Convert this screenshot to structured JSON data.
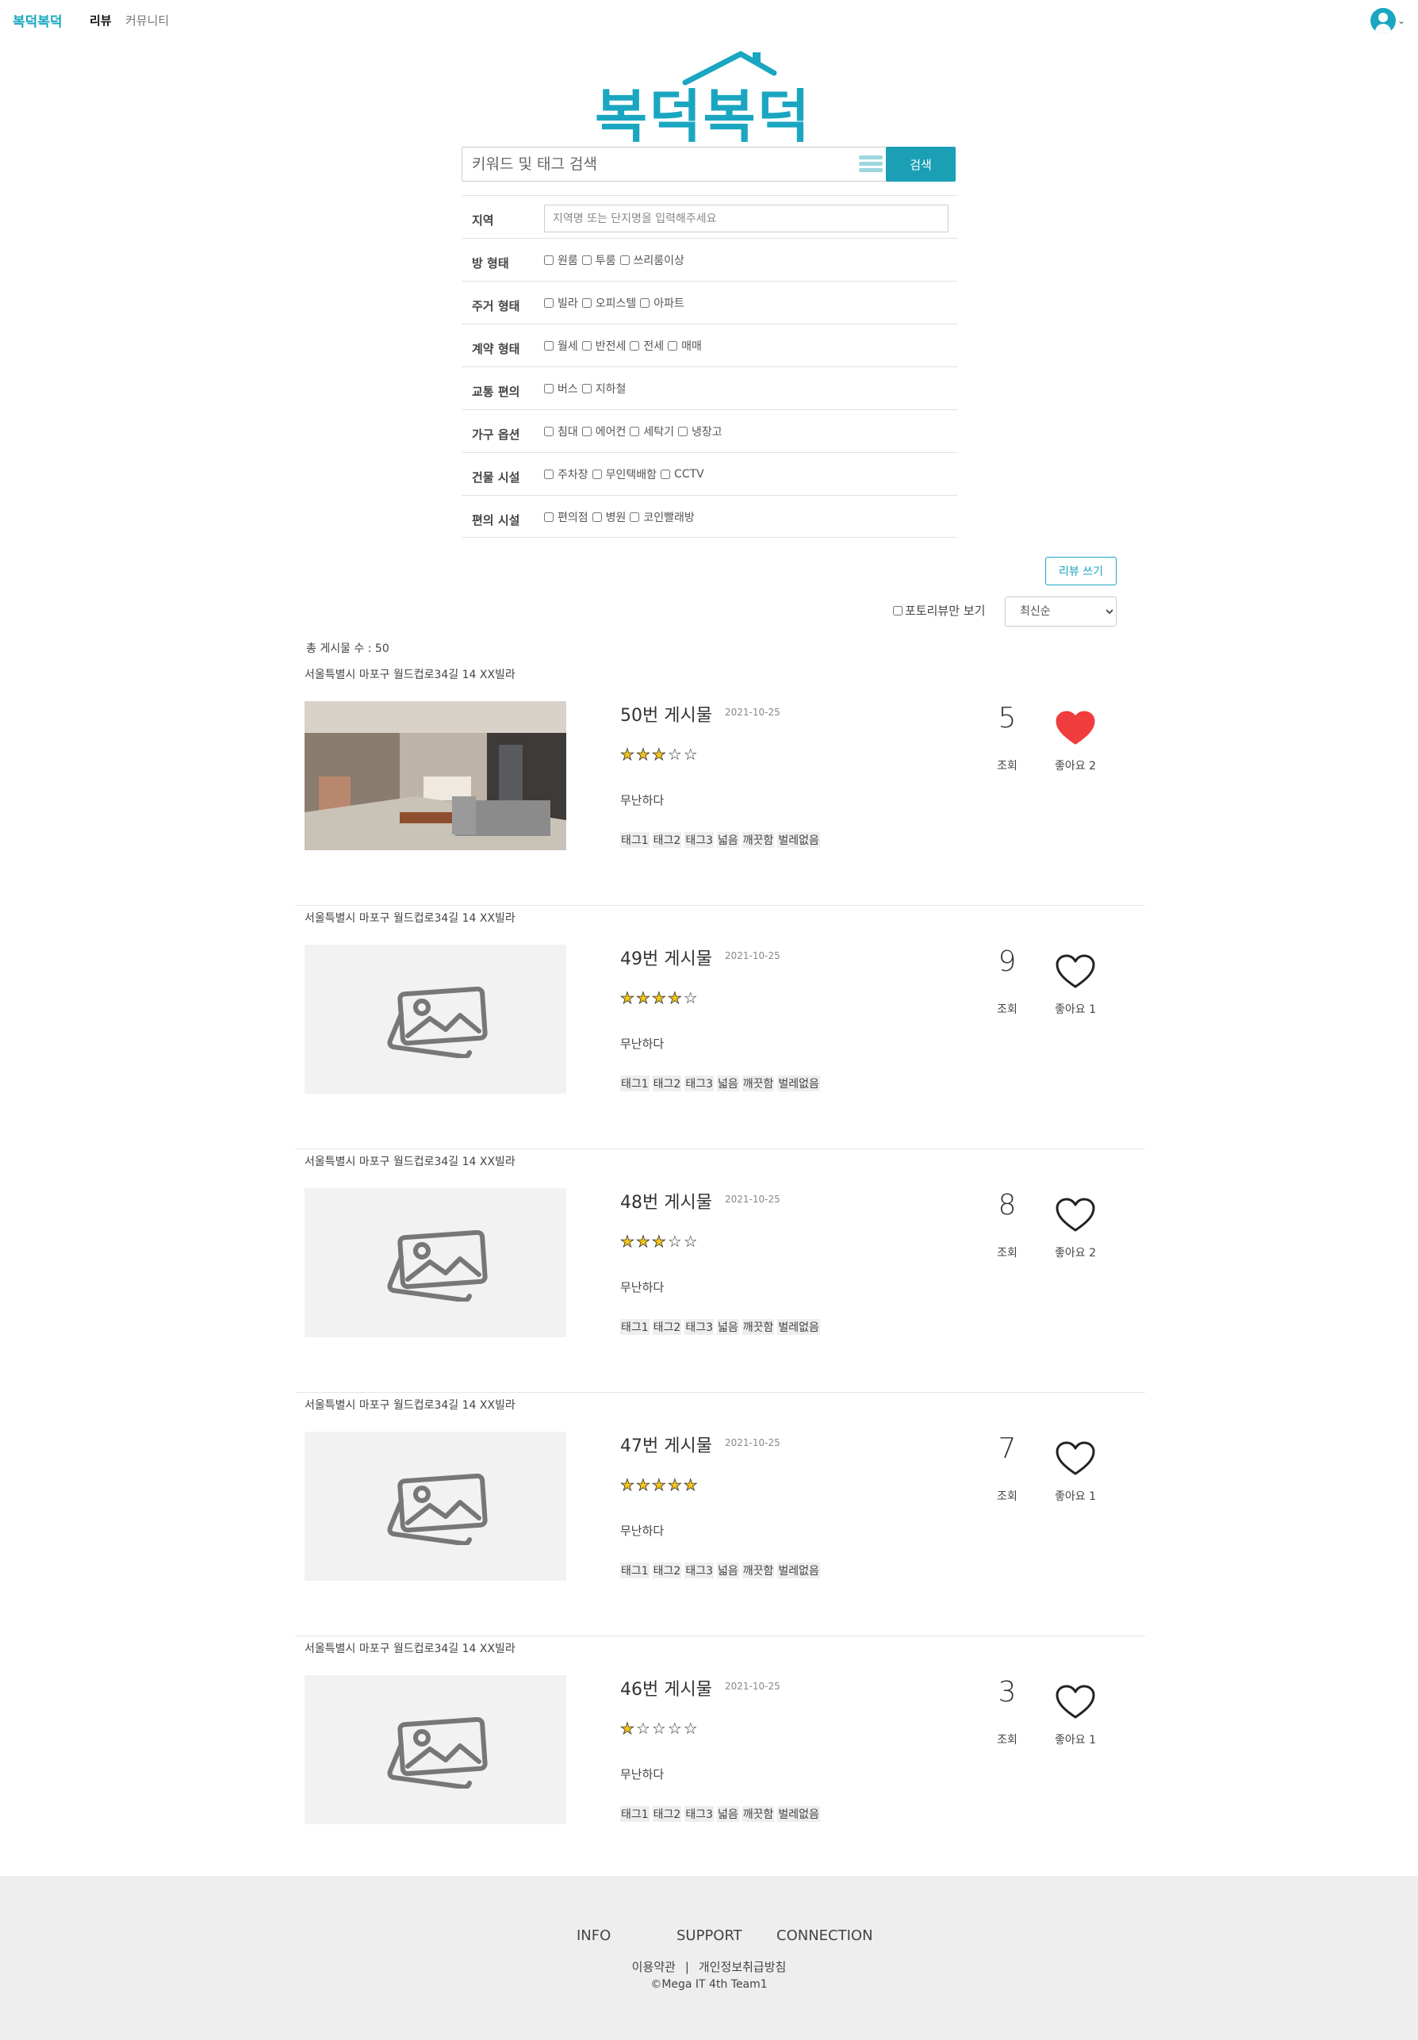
{
  "nav": {
    "brand": "복덕복덕",
    "review": "리뷰",
    "community": "커뮤니티",
    "user_icon": "user-circle-icon",
    "caret_icon": "chevron-down-icon"
  },
  "logo": {
    "text": "복덕복덕",
    "color": "#1aa6c0"
  },
  "search": {
    "placeholder": "키워드 및 태그 검색",
    "button_label": "검색"
  },
  "filters": {
    "region": {
      "label": "지역",
      "placeholder": "지역명 또는 단지명을 입력해주세요"
    },
    "groups": [
      {
        "label": "방 형태",
        "options": [
          "원룸",
          "투룸",
          "쓰리룸이상"
        ]
      },
      {
        "label": "주거 형태",
        "options": [
          "빌라",
          "오피스텔",
          "아파트"
        ]
      },
      {
        "label": "계약 형태",
        "options": [
          "월세",
          "반전세",
          "전세",
          "매매"
        ]
      },
      {
        "label": "교통 편의",
        "options": [
          "버스",
          "지하철"
        ]
      },
      {
        "label": "가구 옵션",
        "options": [
          "침대",
          "에어컨",
          "세탁기",
          "냉장고"
        ]
      },
      {
        "label": "건물 시설",
        "options": [
          "주차장",
          "무인택배함",
          "CCTV"
        ]
      },
      {
        "label": "편의 시설",
        "options": [
          "편의점",
          "병원",
          "코인빨래방"
        ]
      }
    ]
  },
  "controls": {
    "write_button": "리뷰 쓰기",
    "photo_only": "포토리뷰만 보기",
    "sort_selected": "최신순",
    "total_count": "총 게시물 수 : 50"
  },
  "reviews": [
    {
      "address": "서울특별시 마포구 월드컵로34길 14 XX빌라",
      "title": "50번 게시물",
      "date": "2021-10-25",
      "rating": 3,
      "summary": "무난하다",
      "tags": [
        "태그1",
        "태그2",
        "태그3",
        "넓음",
        "깨끗함",
        "벌레없음"
      ],
      "views": "5",
      "views_label": "조회",
      "likes": "좋아요 2",
      "liked": true,
      "has_photo": true
    },
    {
      "address": "서울특별시 마포구 월드컵로34길 14 XX빌라",
      "title": "49번 게시물",
      "date": "2021-10-25",
      "rating": 4,
      "summary": "무난하다",
      "tags": [
        "태그1",
        "태그2",
        "태그3",
        "넓음",
        "깨끗함",
        "벌레없음"
      ],
      "views": "9",
      "views_label": "조회",
      "likes": "좋아요 1",
      "liked": false,
      "has_photo": false
    },
    {
      "address": "서울특별시 마포구 월드컵로34길 14 XX빌라",
      "title": "48번 게시물",
      "date": "2021-10-25",
      "rating": 3,
      "summary": "무난하다",
      "tags": [
        "태그1",
        "태그2",
        "태그3",
        "넓음",
        "깨끗함",
        "벌레없음"
      ],
      "views": "8",
      "views_label": "조회",
      "likes": "좋아요 2",
      "liked": false,
      "has_photo": false
    },
    {
      "address": "서울특별시 마포구 월드컵로34길 14 XX빌라",
      "title": "47번 게시물",
      "date": "2021-10-25",
      "rating": 5,
      "summary": "무난하다",
      "tags": [
        "태그1",
        "태그2",
        "태그3",
        "넓음",
        "깨끗함",
        "벌레없음"
      ],
      "views": "7",
      "views_label": "조회",
      "likes": "좋아요 1",
      "liked": false,
      "has_photo": false
    },
    {
      "address": "서울특별시 마포구 월드컵로34길 14 XX빌라",
      "title": "46번 게시물",
      "date": "2021-10-25",
      "rating": 1,
      "summary": "무난하다",
      "tags": [
        "태그1",
        "태그2",
        "태그3",
        "넓음",
        "깨끗함",
        "벌레없음"
      ],
      "views": "3",
      "views_label": "조회",
      "likes": "좋아요 1",
      "liked": false,
      "has_photo": false
    }
  ],
  "footer": {
    "links": [
      "INFO",
      "SUPPORT",
      "CONNECTION"
    ],
    "terms": "이용약관",
    "separator": "|",
    "privacy": "개인정보취급방침",
    "copyright": "©Mega IT 4th Team1"
  },
  "colors": {
    "accent": "#1aa6c0",
    "button": "#1a9fb5",
    "liked_heart": "#f03c3c",
    "star": "#f5c518",
    "footer_bg": "#eeeeee"
  }
}
